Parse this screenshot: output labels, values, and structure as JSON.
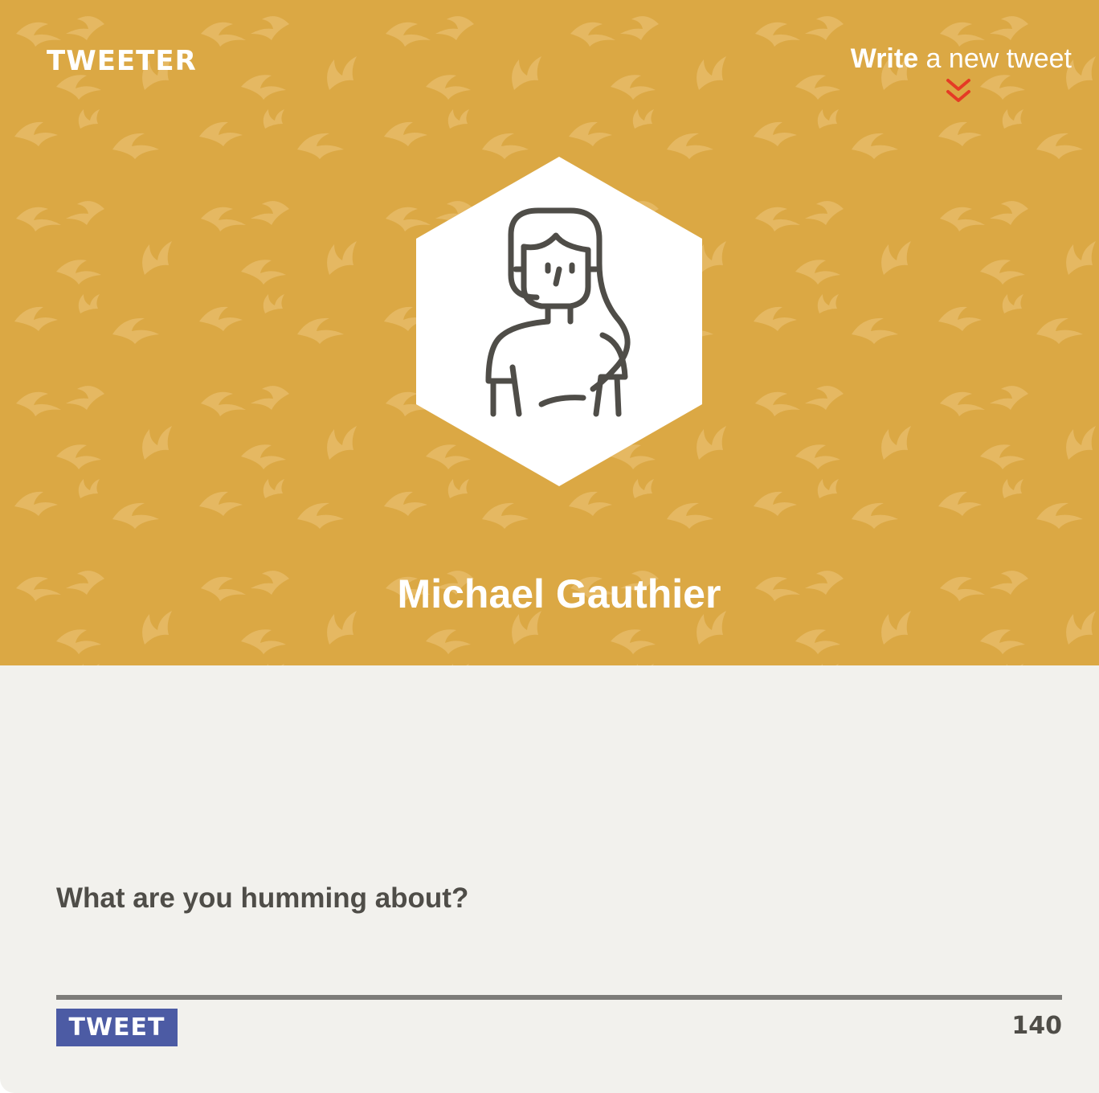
{
  "header": {
    "logo": "TWEETER",
    "write_link": {
      "strong": "Write",
      "rest": " a new tweet"
    },
    "chevron_icon": "double-chevron-down-icon",
    "background_color": "#dba844",
    "pattern_icon": "bird-icon"
  },
  "profile": {
    "avatar_icon": "user-avatar-icon",
    "name": "Michael Gauthier"
  },
  "compose": {
    "placeholder": "What are you humming about?",
    "value": "",
    "button_label": "TWEET",
    "button_color": "#4c5ba4",
    "char_count": "140"
  }
}
